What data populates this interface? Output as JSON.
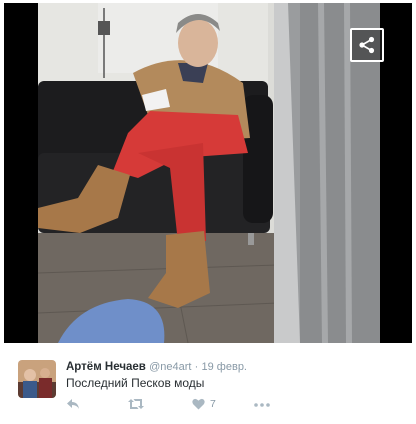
{
  "colors": {
    "icon_gray": "#aab8c2",
    "name_text": "#292f33",
    "meta_text": "#8899a6",
    "background": "#ffffff"
  },
  "photo": {
    "share_icon": "share-icon"
  },
  "tweet": {
    "author_name": "Артём Нечаев",
    "handle": "@ne4art",
    "separator": "·",
    "time": "19 февр.",
    "text": "Последний Песков моды",
    "actions": {
      "reply_icon": "reply-icon",
      "retweet_icon": "retweet-icon",
      "like_icon": "heart-icon",
      "like_count": "7",
      "more_icon": "more-icon"
    }
  }
}
